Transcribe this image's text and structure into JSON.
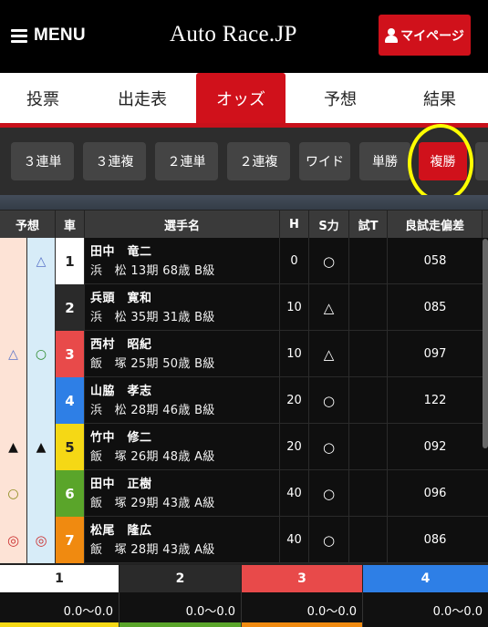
{
  "header": {
    "menu_label": "MENU",
    "logo_text": "Auto Race.JP",
    "mypage_label": "マイページ"
  },
  "tabs": [
    {
      "label": "投票",
      "active": false
    },
    {
      "label": "出走表",
      "active": false
    },
    {
      "label": "オッズ",
      "active": true
    },
    {
      "label": "予想",
      "active": false
    },
    {
      "label": "結果",
      "active": false
    }
  ],
  "bet_types": [
    {
      "label": "３連単",
      "active": false
    },
    {
      "label": "３連複",
      "active": false
    },
    {
      "label": "２連単",
      "active": false
    },
    {
      "label": "２連複",
      "active": false
    },
    {
      "label": "ワイド",
      "active": false
    },
    {
      "label": "単勝",
      "active": false
    },
    {
      "label": "複勝",
      "active": true
    }
  ],
  "table": {
    "headers": {
      "prediction": "予想",
      "car": "車",
      "player": "選手名",
      "handicap": "H",
      "s_power": "S力",
      "trial": "試T",
      "trial_deviation": "良試走偏差"
    },
    "rows": [
      {
        "pred1": "",
        "pred2": "△",
        "car": "1",
        "name": "田中　竜二",
        "info": "浜　松 13期 68歳 B級",
        "h": "0",
        "s": "○",
        "trial": "",
        "dev": "058"
      },
      {
        "pred1": "",
        "pred2": "",
        "car": "2",
        "name": "兵頭　寛和",
        "info": "浜　松 35期 31歳 B級",
        "h": "10",
        "s": "△",
        "trial": "",
        "dev": "085"
      },
      {
        "pred1": "△",
        "pred2": "○",
        "car": "3",
        "name": "西村　昭紀",
        "info": "飯　塚 25期 50歳 B級",
        "h": "10",
        "s": "△",
        "trial": "",
        "dev": "097"
      },
      {
        "pred1": "",
        "pred2": "",
        "car": "4",
        "name": "山脇　孝志",
        "info": "浜　松 28期 46歳 B級",
        "h": "20",
        "s": "○",
        "trial": "",
        "dev": "122"
      },
      {
        "pred1": "▲",
        "pred2": "▲",
        "car": "5",
        "name": "竹中　修二",
        "info": "飯　塚 26期 48歳 A級",
        "h": "20",
        "s": "○",
        "trial": "",
        "dev": "092"
      },
      {
        "pred1": "○",
        "pred2": "",
        "car": "6",
        "name": "田中　正樹",
        "info": "飯　塚 29期 43歳 A級",
        "h": "40",
        "s": "○",
        "trial": "",
        "dev": "096"
      },
      {
        "pred1": "◎",
        "pred2": "◎",
        "car": "7",
        "name": "松尾　隆広",
        "info": "飯　塚 28期 43歳 A級",
        "h": "40",
        "s": "○",
        "trial": "",
        "dev": "086"
      }
    ]
  },
  "summary": [
    {
      "car": "1",
      "odds": "0.0〜0.0"
    },
    {
      "car": "2",
      "odds": "0.0〜0.0"
    },
    {
      "car": "3",
      "odds": "0.0〜0.0"
    },
    {
      "car": "4",
      "odds": "0.0〜0.0"
    }
  ],
  "colors": {
    "brand_red": "#d0111b",
    "highlight": "#ffff00",
    "car_colors": [
      "#ffffff",
      "#2a2a2a",
      "#e84a4a",
      "#2e7fe6",
      "#f5d815",
      "#5aa52a",
      "#f08a10"
    ]
  }
}
